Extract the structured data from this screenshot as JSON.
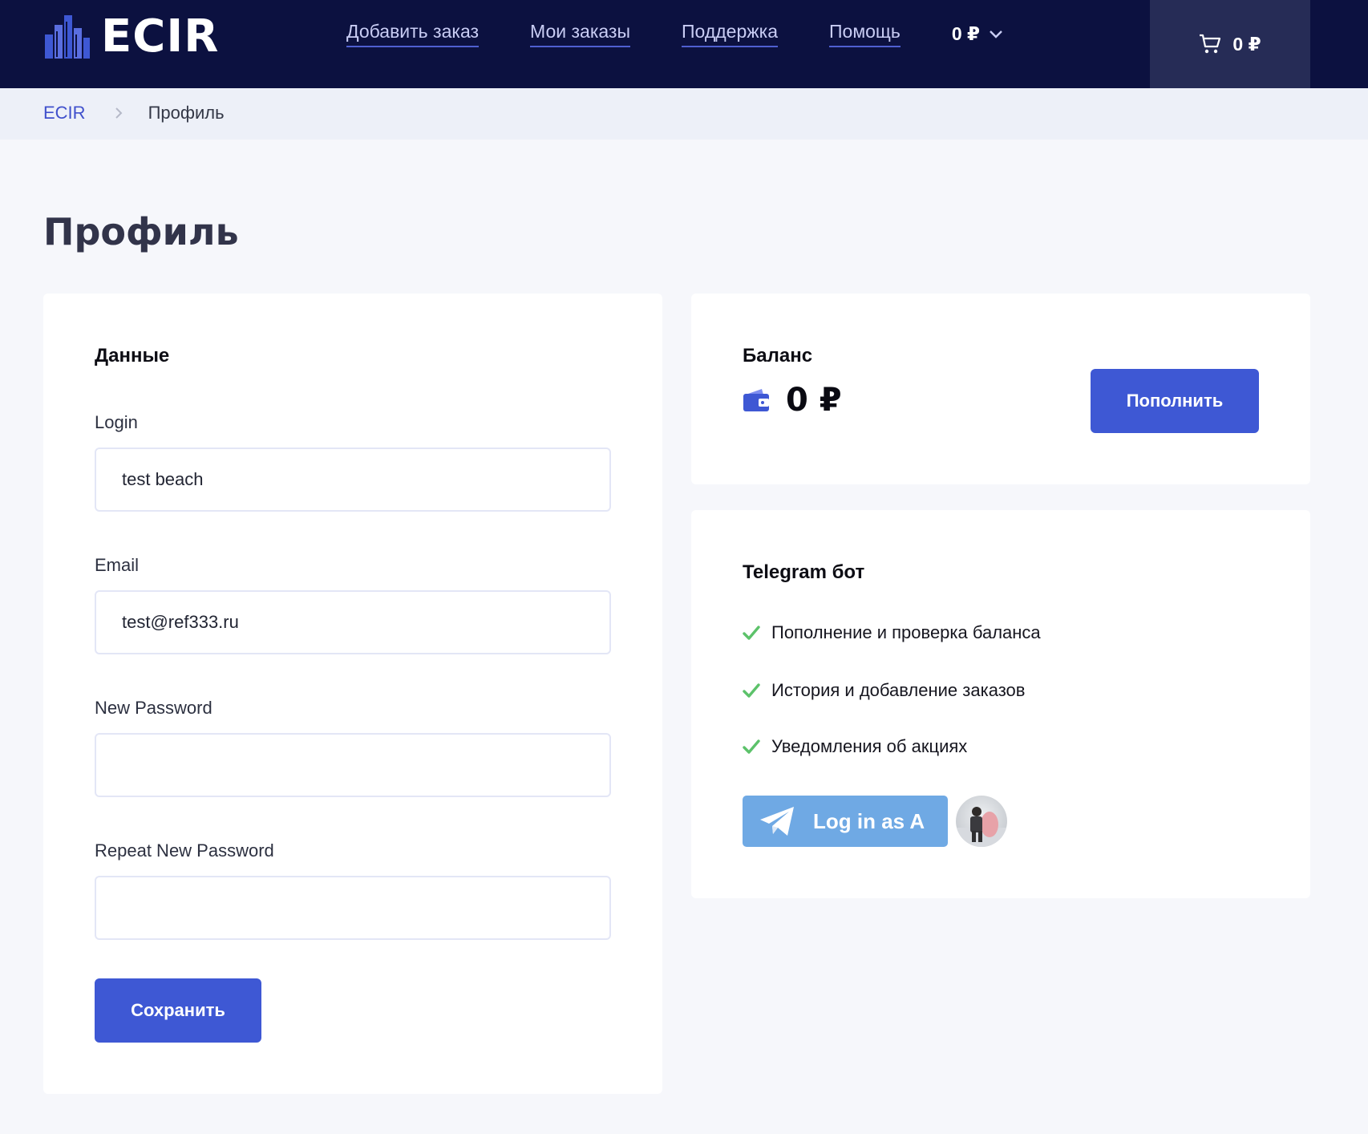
{
  "brand": {
    "name": "ECIR",
    "accent": "#3e58d4",
    "nav_bg": "#0c1140"
  },
  "nav": {
    "links": [
      "Добавить заказ",
      "Мои заказы",
      "Поддержка",
      "Помощь"
    ],
    "balance": "0 ₽"
  },
  "cart": {
    "icon": "cart-icon",
    "total": "0 ₽"
  },
  "breadcrumb": {
    "home": "ECIR",
    "current": "Профиль"
  },
  "page": {
    "title": "Профиль"
  },
  "data_card": {
    "heading": "Данные",
    "login_label": "Login",
    "login_value": "test beach",
    "email_label": "Email",
    "email_value": "test@ref333.ru",
    "new_password_label": "New Password",
    "repeat_password_label": "Repeat New Password",
    "save_button": "Сохранить"
  },
  "balance_card": {
    "heading": "Баланс",
    "icon": "wallet-icon",
    "amount": "0 ₽",
    "topup_button": "Пополнить"
  },
  "telegram_card": {
    "heading": "Telegram бот",
    "features": [
      "Пополнение и проверка баланса",
      "История и добавление заказов",
      "Уведомления об акциях"
    ],
    "check_color": "#5cc26a",
    "login_button": "Log in as A",
    "login_button_color": "#6fa9e4"
  }
}
